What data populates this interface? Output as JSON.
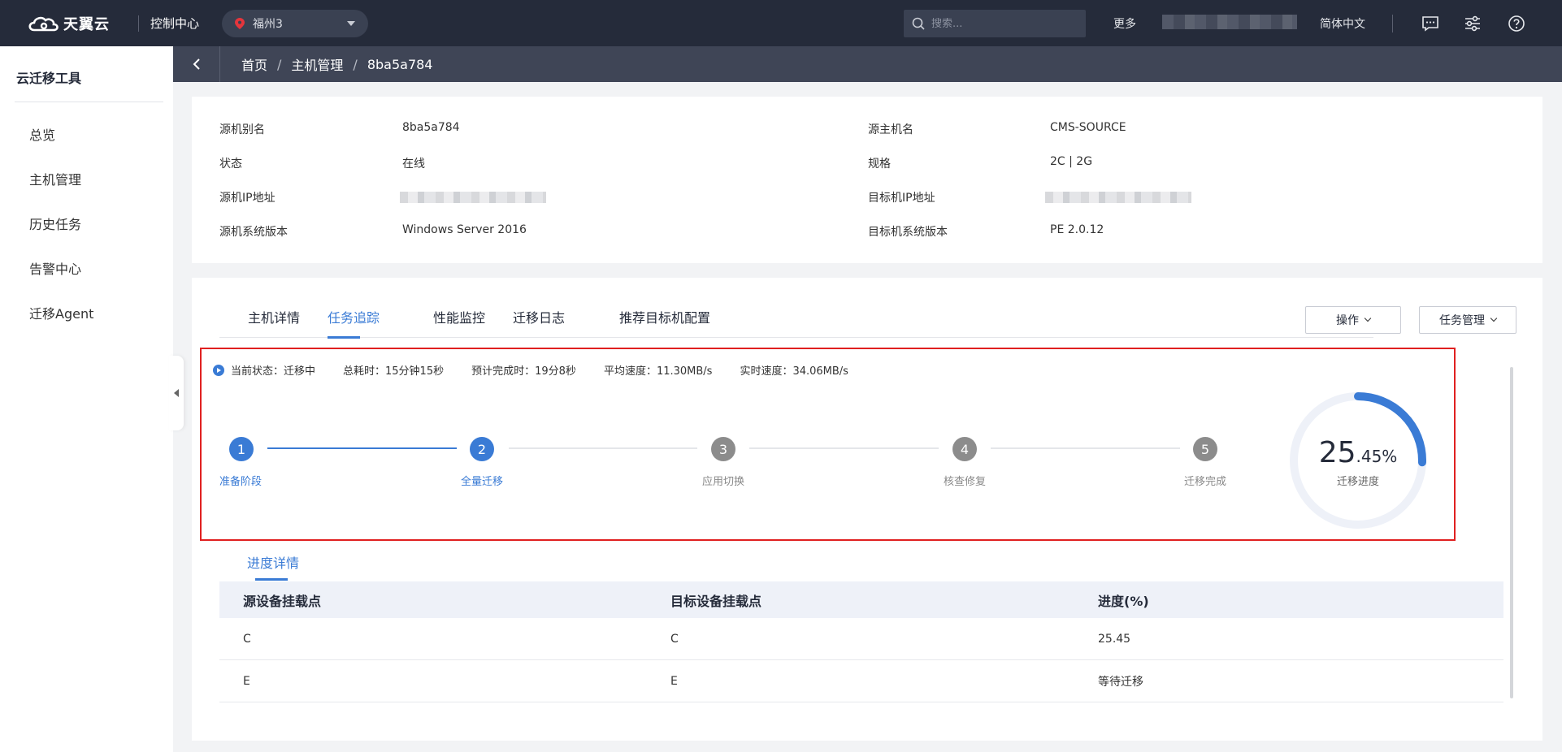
{
  "topbar": {
    "brand": "天翼云",
    "console": "控制中心",
    "region": "福州3",
    "search_placeholder": "搜索...",
    "more": "更多",
    "language": "简体中文",
    "icons": [
      "message-icon",
      "settings-sliders-icon",
      "help-icon"
    ]
  },
  "sidebar": {
    "title": "云迁移工具",
    "items": [
      "总览",
      "主机管理",
      "历史任务",
      "告警中心",
      "迁移Agent"
    ]
  },
  "breadcrumb": {
    "items": [
      "首页",
      "主机管理",
      "8ba5a784"
    ]
  },
  "info": {
    "left": [
      {
        "label": "源机别名",
        "value": "8ba5a784"
      },
      {
        "label": "状态",
        "value": "在线"
      },
      {
        "label": "源机IP地址",
        "value": ""
      },
      {
        "label": "源机系统版本",
        "value": "Windows Server 2016"
      }
    ],
    "right": [
      {
        "label": "源主机名",
        "value": "CMS-SOURCE"
      },
      {
        "label": "规格",
        "value": "2C | 2G"
      },
      {
        "label": "目标机IP地址",
        "value": ""
      },
      {
        "label": "目标机系统版本",
        "value": "PE 2.0.12"
      }
    ]
  },
  "tabs": [
    "主机详情",
    "任务追踪",
    "性能监控",
    "迁移日志",
    "推荐目标机配置"
  ],
  "active_tab": 1,
  "actions": {
    "operate": "操作",
    "task_manage": "任务管理"
  },
  "status": {
    "current": "当前状态：迁移中",
    "elapsed": "总耗时：15分钟15秒",
    "eta": "预计完成时：19分8秒",
    "avg_speed": "平均速度：11.30MB/s",
    "realtime_speed": "实时速度：34.06MB/s"
  },
  "steps": [
    {
      "num": "1",
      "label": "准备阶段",
      "state": "done"
    },
    {
      "num": "2",
      "label": "全量迁移",
      "state": "active"
    },
    {
      "num": "3",
      "label": "应用切换",
      "state": "pending"
    },
    {
      "num": "4",
      "label": "核查修复",
      "state": "pending"
    },
    {
      "num": "5",
      "label": "迁移完成",
      "state": "pending"
    }
  ],
  "progress": {
    "integer": "25",
    "decimal": ".45%",
    "label": "迁移进度",
    "percent": 25.45
  },
  "detail_tab": "进度详情",
  "table": {
    "headers": [
      "源设备挂载点",
      "目标设备挂载点",
      "进度(%)"
    ],
    "rows": [
      [
        "C",
        "C",
        "25.45"
      ],
      [
        "E",
        "E",
        "等待迁移"
      ]
    ]
  },
  "colors": {
    "accent": "#3a7bd5",
    "topbar": "#252b3a",
    "highlight_border": "#e02020",
    "pending_step": "#8c8c8c"
  }
}
